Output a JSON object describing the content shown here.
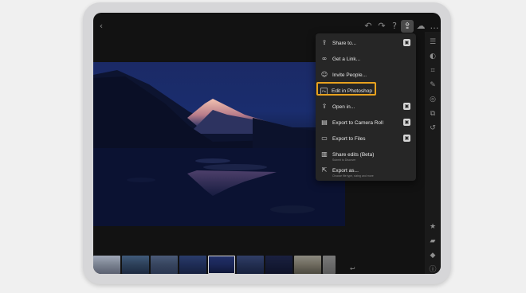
{
  "topbar": {
    "back_icon": "chevron-left-icon",
    "undo_icon": "undo-icon",
    "redo_icon": "redo-icon",
    "help_icon": "help-icon",
    "share_icon": "share-icon",
    "cloud_icon": "cloud-icon",
    "more_icon": "more-icon"
  },
  "share_menu": {
    "items": [
      {
        "label": "Share to...",
        "icon": "share-icon",
        "badge": true
      },
      {
        "label": "Get a Link...",
        "icon": "link-icon",
        "badge": false
      },
      {
        "label": "Invite People...",
        "icon": "people-icon",
        "badge": false
      },
      {
        "label": "Edit in Photoshop",
        "icon": "photoshop-icon",
        "badge": false,
        "highlighted": true
      },
      {
        "label": "Open in...",
        "icon": "open-in-icon",
        "badge": true
      },
      {
        "label": "Export to Camera Roll",
        "icon": "camera-roll-icon",
        "badge": true
      },
      {
        "label": "Export to Files",
        "icon": "folder-icon",
        "badge": true
      },
      {
        "label": "Share edits (Beta)",
        "sub": "Submit to Discover",
        "icon": "share-edits-icon",
        "badge": false
      },
      {
        "label": "Export as...",
        "sub": "Choose file type, sizing and more",
        "icon": "export-icon",
        "badge": false
      }
    ]
  },
  "right_rail": {
    "icons": [
      "sliders-icon",
      "presets-icon",
      "crop-icon",
      "brush-icon",
      "healing-icon",
      "versions-icon",
      "history-icon",
      "star-icon",
      "comment-icon",
      "tag-icon",
      "info-icon"
    ]
  },
  "colors": {
    "highlight": "#e8a21f",
    "menu_bg": "#262626",
    "screen_bg": "#121212"
  }
}
